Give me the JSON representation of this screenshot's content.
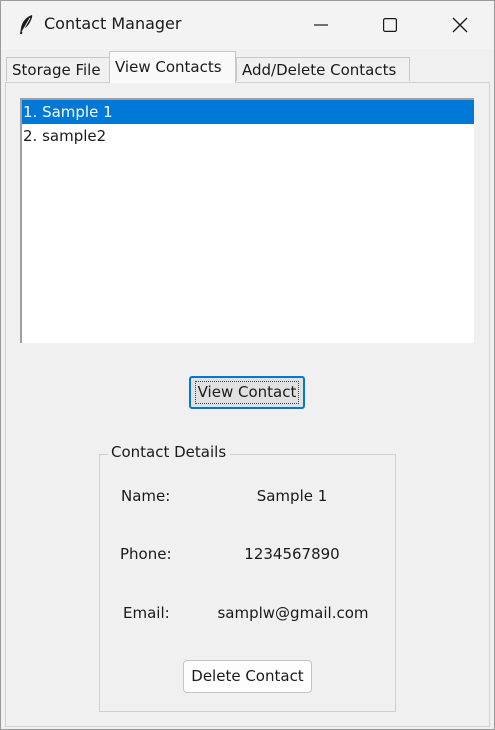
{
  "window": {
    "title": "Contact Manager",
    "controls": {
      "minimize_icon": "minimize-icon",
      "maximize_icon": "maximize-icon",
      "close_icon": "close-icon"
    }
  },
  "tabs": [
    {
      "label": "Storage File",
      "active": false
    },
    {
      "label": "View Contacts",
      "active": true
    },
    {
      "label": "Add/Delete Contacts",
      "active": false
    }
  ],
  "contacts_list": {
    "items": [
      {
        "label": "1. Sample 1",
        "selected": true
      },
      {
        "label": "2. sample2",
        "selected": false
      }
    ]
  },
  "actions": {
    "view_contact_label": "View Contact",
    "delete_contact_label": "Delete Contact"
  },
  "details": {
    "legend": "Contact Details",
    "name_label": "Name:",
    "name_value": "Sample 1",
    "phone_label": "Phone:",
    "phone_value": "1234567890",
    "email_label": "Email:",
    "email_value": "samplw@gmail.com"
  },
  "colors": {
    "selection": "#0078d7",
    "focus_border": "#0078d7",
    "window_bg": "#f0f0f0"
  }
}
